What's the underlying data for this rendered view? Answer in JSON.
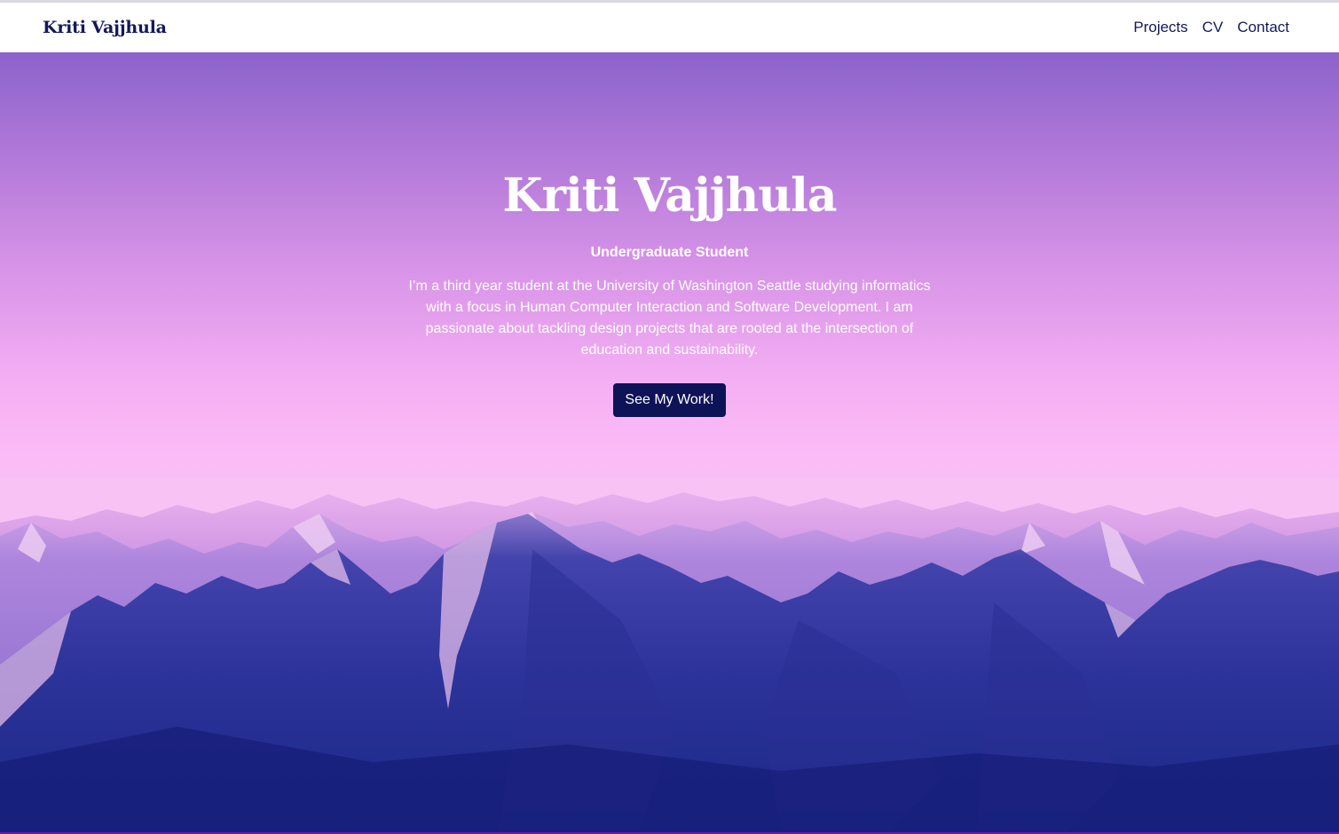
{
  "nav": {
    "brand": "Kriti Vajjhula",
    "links": [
      "Projects",
      "CV",
      "Contact"
    ]
  },
  "hero": {
    "title": "Kriti Vajjhula",
    "subtitle": "Undergraduate Student",
    "bio": "I’m a third year student at the University of Washington Seattle studying informatics with a focus in Human Computer Interaction and Software Development. I am passionate about tackling design projects that are rooted at the intersection of education and sustainability.",
    "cta_label": "See My Work!"
  },
  "colors": {
    "navy": "#14185a",
    "button": "#0e1358",
    "sky_top": "#8b63cc",
    "sky_mid": "#fbbcf6",
    "mountain_dark": "#1e2a8c"
  }
}
